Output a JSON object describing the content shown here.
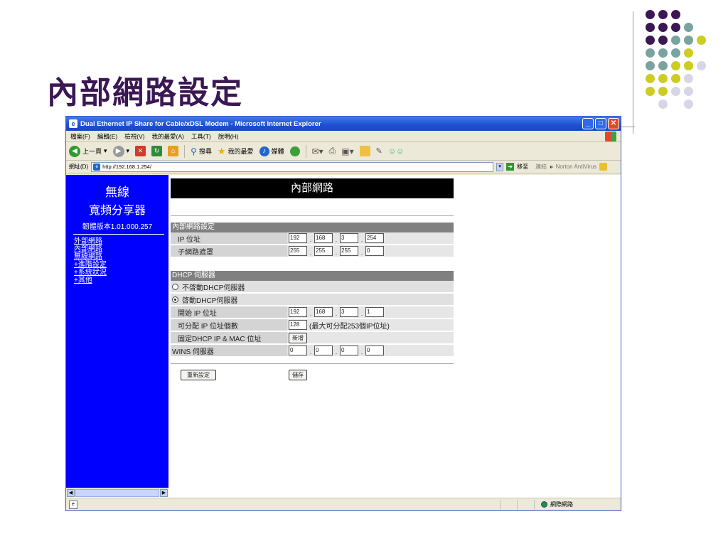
{
  "slide": {
    "title": "內部網路設定",
    "dot_colors": {
      "purple": "#3b1754",
      "teal": "#78a3a0",
      "yellow": "#cccc22",
      "lavender": "#d6d6e6"
    }
  },
  "browser": {
    "window_title": "Dual Ethernet IP Share for Cable/xDSL Modem - Microsoft Internet Explorer",
    "menu": [
      "檔案(F)",
      "編輯(E)",
      "檢視(V)",
      "我的最愛(A)",
      "工具(T)",
      "說明(H)"
    ],
    "toolbar": {
      "back": "上一頁",
      "search": "搜尋",
      "favorites": "我的最愛",
      "media": "媒體"
    },
    "address_label": "網址(D)",
    "url": "http://192.168.1.254/",
    "go_label": "移至",
    "links_label": "連結",
    "norton": "Norton AntiVirus",
    "status_zone": "網際網路"
  },
  "sidebar": {
    "title_line1": "無線",
    "title_line2": "寬頻分享器",
    "firmware": "韌體版本1.01.000.257",
    "links": [
      "外部網路",
      "內部網路",
      "無線網路",
      "+進階設定",
      "+系統狀況",
      "+其他"
    ]
  },
  "main": {
    "banner": "內部網路",
    "lan_section": "內部網路設定",
    "ip_label": "IP 位址",
    "ip": [
      "192",
      "168",
      "3",
      "254"
    ],
    "mask_label": "子網路遮罩",
    "mask": [
      "255",
      "255",
      "255",
      "0"
    ],
    "dhcp_section": "DHCP 伺服器",
    "dhcp_off": "不啓動DHCP伺服器",
    "dhcp_on": "啓動DHCP伺服器",
    "start_ip_label": "開始 IP 位址",
    "start_ip": [
      "192",
      "168",
      "3",
      "1"
    ],
    "count_label": "可分配 IP 位址個數",
    "count_value": "128",
    "count_hint": "(最大可分配253個IP位址)",
    "fixed_label": "固定DHCP IP & MAC 位址",
    "add_button": "新增",
    "wins_label": "WINS 伺服器",
    "wins": [
      "0",
      "0",
      "0",
      "0"
    ],
    "reset_button": "重新設定",
    "save_button": "儲存"
  }
}
